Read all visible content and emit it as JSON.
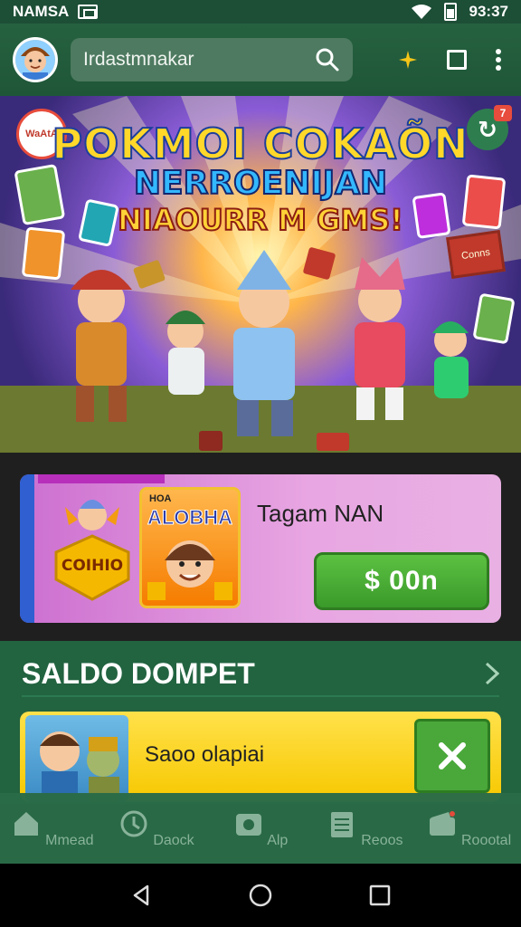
{
  "status_bar": {
    "carrier": "NAMSA",
    "time": "93:37"
  },
  "app_bar": {
    "search_value": "Irdastmnakar"
  },
  "hero": {
    "title_line1": "POKMOI COKAÕN",
    "title_line2": "NERROENIJAN",
    "title_line3": "NIAOURR M GMS!",
    "badge_text": "WaAtA",
    "refresh_count": "7",
    "sign_text": "Conns"
  },
  "promo": {
    "emblem_text": "COIHIO",
    "thumb_tag": "HOA",
    "thumb_title": "ALOBHA",
    "title": "Tagam NAN",
    "price_button": "$ 00n"
  },
  "saldo": {
    "title": "SALDO DOMPET",
    "card_text": "Saoo olapiai"
  },
  "bottom_nav": {
    "items": [
      {
        "label": "Mmead",
        "icon": "home-icon"
      },
      {
        "label": "Daock",
        "icon": "clock-icon"
      },
      {
        "label": "Alp",
        "icon": "camera-icon"
      },
      {
        "label": "Reoos",
        "icon": "list-icon"
      },
      {
        "label": "Roootal",
        "icon": "wallet-icon"
      }
    ]
  },
  "colors": {
    "primary_green": "#226340",
    "app_bar_green": "#25613f",
    "promo_pink": "#e8a6e2",
    "button_green": "#4aa83a",
    "yellow_card": "#ffe14a"
  }
}
